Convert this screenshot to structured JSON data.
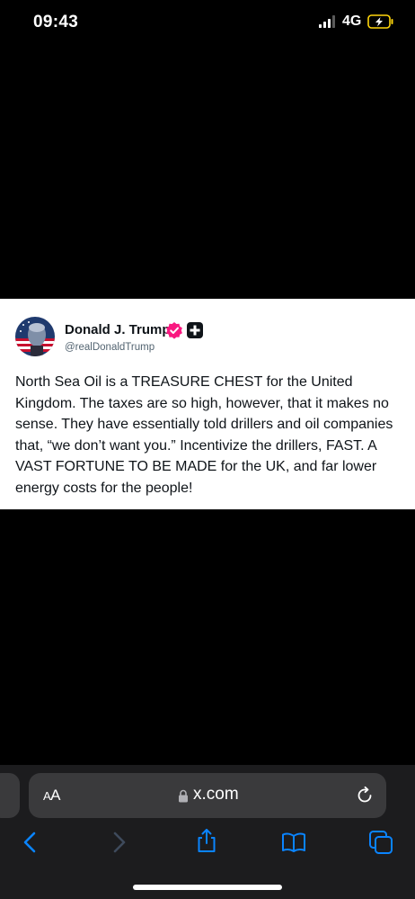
{
  "status_bar": {
    "time": "09:43",
    "network": "4G",
    "signal_icon": "signal-bars-icon",
    "battery_icon": "battery-charging-icon",
    "battery_color": "#ffd60a"
  },
  "post": {
    "display_name": "Donald J. Trump",
    "handle": "@realDonaldTrump",
    "verified_icon": "verified-badge-icon",
    "verified_color": "#f91880",
    "affiliation_icon": "plus-badge-icon",
    "text": "North Sea Oil is a TREASURE CHEST for the United Kingdom. The taxes are so high, however, that it makes no sense. They have essentially told drillers and oil companies that, “we don’t want you.” Incentivize the drillers, FAST. A VAST FORTUNE TO BE MADE for the UK, and far lower energy costs for the people!"
  },
  "browser": {
    "reader_label_big": "A",
    "reader_label_small": "A",
    "url": "x.com",
    "lock_icon": "lock-icon",
    "reload_icon": "reload-icon",
    "accent_color": "#0a84ff",
    "toolbar": [
      {
        "name": "back-icon",
        "enabled": true
      },
      {
        "name": "forward-icon",
        "enabled": false
      },
      {
        "name": "share-icon",
        "enabled": true
      },
      {
        "name": "bookmarks-icon",
        "enabled": true
      },
      {
        "name": "tabs-icon",
        "enabled": true
      }
    ]
  }
}
